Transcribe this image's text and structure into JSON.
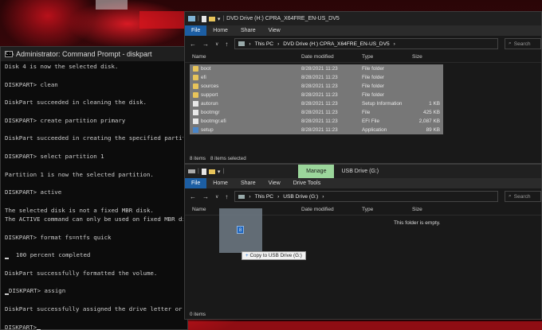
{
  "cmd": {
    "title": "Administrator: Command Prompt - diskpart",
    "lines": [
      "Disk 4 is now the selected disk.",
      "",
      "DISKPART> clean",
      "",
      "DiskPart succeeded in cleaning the disk.",
      "",
      "DISKPART> create partition primary",
      "",
      "DiskPart succeeded in creating the specified partitio",
      "",
      "DISKPART> select partition 1",
      "",
      "Partition 1 is now the selected partition.",
      "",
      "DISKPART> active",
      "",
      "The selected disk is not a fixed MBR disk.",
      "The ACTIVE command can only be used on fixed MBR disk",
      "",
      "DISKPART> format fs=ntfs quick",
      "",
      "  100 percent completed",
      "",
      "DiskPart successfully formatted the volume.",
      "",
      "DISKPART> assign",
      "",
      "DiskPart successfully assigned the drive letter or mo",
      "",
      "DISKPART>"
    ]
  },
  "explorer_dvd": {
    "title": "DVD Drive (H:) CPRA_X64FRE_EN-US_DV5",
    "tabs": [
      "File",
      "Home",
      "Share",
      "View"
    ],
    "path": [
      "This PC",
      "DVD Drive (H:) CPRA_X64FRE_EN-US_DV5"
    ],
    "search_placeholder": "Search",
    "columns": [
      "Name",
      "Date modified",
      "Type",
      "Size"
    ],
    "rows": [
      {
        "name": "boot",
        "date": "8/28/2021 11:23",
        "type": "File folder",
        "size": "",
        "icon": "folder-icon",
        "selected": true
      },
      {
        "name": "efi",
        "date": "8/28/2021 11:23",
        "type": "File folder",
        "size": "",
        "icon": "folder-icon",
        "selected": true
      },
      {
        "name": "sources",
        "date": "8/28/2021 11:23",
        "type": "File folder",
        "size": "",
        "icon": "folder-icon",
        "selected": true
      },
      {
        "name": "support",
        "date": "8/28/2021 11:23",
        "type": "File folder",
        "size": "",
        "icon": "folder-icon",
        "selected": true
      },
      {
        "name": "autorun",
        "date": "8/28/2021 11:23",
        "type": "Setup Information",
        "size": "1 KB",
        "icon": "inf-file-icon",
        "selected": true
      },
      {
        "name": "bootmgr",
        "date": "8/28/2021 11:23",
        "type": "File",
        "size": "425 KB",
        "icon": "file-icon",
        "selected": true
      },
      {
        "name": "bootmgr.efi",
        "date": "8/28/2021 11:23",
        "type": "EFI File",
        "size": "2,087 KB",
        "icon": "file-icon",
        "selected": true
      },
      {
        "name": "setup",
        "date": "8/28/2021 11:23",
        "type": "Application",
        "size": "89 KB",
        "icon": "setup-icon",
        "selected": true
      }
    ],
    "status": {
      "count": "8 items",
      "selected": "8 items selected"
    }
  },
  "explorer_usb": {
    "title": "USB Drive (G:)",
    "manage_tab": "Manage",
    "tabs": [
      "File",
      "Home",
      "Share",
      "View",
      "Drive Tools"
    ],
    "path": [
      "This PC",
      "USB Drive (G:)"
    ],
    "search_placeholder": "Search",
    "columns": [
      "Name",
      "Date modified",
      "Type",
      "Size"
    ],
    "empty_message": "This folder is empty.",
    "drag_count": "8",
    "drag_tooltip": "Copy to USB Drive (G:)",
    "status": {
      "count": "0 items"
    }
  },
  "colors": {
    "accent": "#1c5ea3",
    "manage_tab": "#9bd69b",
    "folder": "#e8c45a"
  }
}
